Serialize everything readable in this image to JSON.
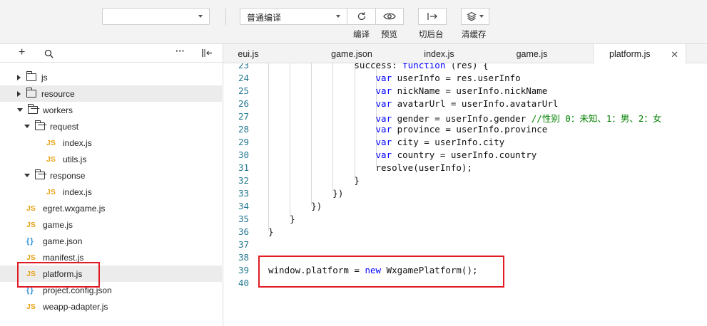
{
  "toolbar": {
    "mode_select": {
      "value": ""
    },
    "compile_select": {
      "value": "普通编译"
    },
    "buttons": [
      {
        "name": "compile-button",
        "icon": "refresh-icon",
        "label": "编译"
      },
      {
        "name": "preview-button",
        "icon": "eye-icon",
        "label": "预览"
      },
      {
        "name": "background-button",
        "icon": "switch-background-icon",
        "label": "切后台"
      },
      {
        "name": "clear-cache-button",
        "icon": "layers-icon",
        "label": "清缓存"
      }
    ]
  },
  "sidebar": {
    "tree": [
      {
        "label": "js",
        "type": "folder",
        "state": "collapsed",
        "depth": 0
      },
      {
        "label": "resource",
        "type": "folder",
        "state": "collapsed",
        "depth": 0,
        "hover": true
      },
      {
        "label": "workers",
        "type": "folder",
        "state": "expanded",
        "depth": 0
      },
      {
        "label": "request",
        "type": "folder",
        "state": "expanded",
        "depth": 1
      },
      {
        "label": "index.js",
        "type": "js",
        "depth": 2
      },
      {
        "label": "utils.js",
        "type": "js",
        "depth": 2
      },
      {
        "label": "response",
        "type": "folder",
        "state": "expanded",
        "depth": 1
      },
      {
        "label": "index.js",
        "type": "js",
        "depth": 2
      },
      {
        "label": "egret.wxgame.js",
        "type": "js",
        "depth": 0
      },
      {
        "label": "game.js",
        "type": "js",
        "depth": 0
      },
      {
        "label": "game.json",
        "type": "json",
        "depth": 0
      },
      {
        "label": "manifest.js",
        "type": "js",
        "depth": 0
      },
      {
        "label": "platform.js",
        "type": "js",
        "depth": 0,
        "selected": true
      },
      {
        "label": "project.config.json",
        "type": "json",
        "depth": 0
      },
      {
        "label": "weapp-adapter.js",
        "type": "js",
        "depth": 0
      }
    ],
    "icon_labels": {
      "js": "JS",
      "json": "{ }"
    }
  },
  "tabs": [
    {
      "label": "eui.js"
    },
    {
      "label": "game.json"
    },
    {
      "label": "index.js"
    },
    {
      "label": "game.js"
    },
    {
      "label": "platform.js",
      "active": true
    }
  ],
  "editor": {
    "lines": [
      {
        "n": "23",
        "code": "                success: function (res) {"
      },
      {
        "n": "24",
        "code": "                    var userInfo = res.userInfo"
      },
      {
        "n": "25",
        "code": "                    var nickName = userInfo.nickName"
      },
      {
        "n": "26",
        "code": "                    var avatarUrl = userInfo.avatarUrl"
      },
      {
        "n": "27",
        "code": "                    var gender = userInfo.gender //性别 0：未知、1：男、2：女"
      },
      {
        "n": "28",
        "code": "                    var province = userInfo.province"
      },
      {
        "n": "29",
        "code": "                    var city = userInfo.city"
      },
      {
        "n": "30",
        "code": "                    var country = userInfo.country"
      },
      {
        "n": "31",
        "code": "                    resolve(userInfo);"
      },
      {
        "n": "32",
        "code": "                }"
      },
      {
        "n": "33",
        "code": "            })"
      },
      {
        "n": "34",
        "code": "        })"
      },
      {
        "n": "35",
        "code": "    }"
      },
      {
        "n": "36",
        "code": "}"
      },
      {
        "n": "37",
        "code": ""
      },
      {
        "n": "38",
        "code": ""
      },
      {
        "n": "39",
        "code": "window.platform = new WxgamePlatform();"
      },
      {
        "n": "40",
        "code": ""
      }
    ],
    "colors": {
      "keyword": "#0000ff",
      "comment": "#008000",
      "line_number": "#237893"
    }
  },
  "highlight_color": "#e01b24"
}
